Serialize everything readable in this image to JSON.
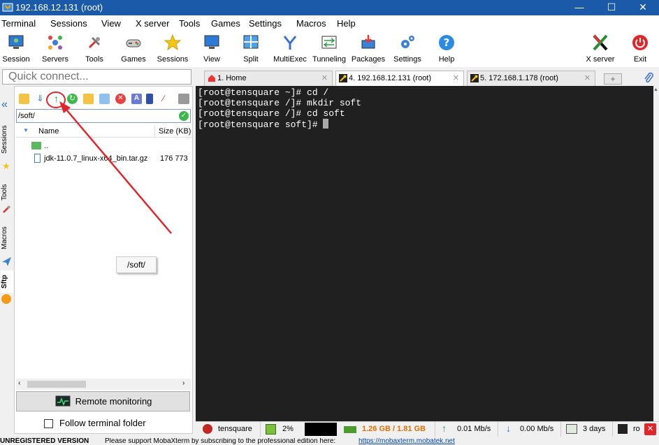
{
  "window": {
    "title": "192.168.12.131 (root)",
    "min": "—",
    "max": "☐",
    "close": "✕"
  },
  "menu": [
    "Terminal",
    "Sessions",
    "View",
    "X server",
    "Tools",
    "Games",
    "Settings",
    "Macros",
    "Help"
  ],
  "toolbar": [
    "Session",
    "Servers",
    "Tools",
    "Games",
    "Sessions",
    "View",
    "Split",
    "MultiExec",
    "Tunneling",
    "Packages",
    "Settings",
    "Help",
    "X server",
    "Exit"
  ],
  "quick_connect": {
    "placeholder": "Quick connect..."
  },
  "tabs": [
    {
      "label": "1. Home"
    },
    {
      "label": "4. 192.168.12.131 (root)"
    },
    {
      "label": "5. 172.168.1.178 (root)"
    }
  ],
  "side_tabs": [
    "Sessions",
    "Tools",
    "Macros",
    "Sftp"
  ],
  "sftp": {
    "path": "/soft/",
    "col_name": "Name",
    "col_size": "Size (KB)",
    "files": [
      {
        "name": "..",
        "size": ""
      },
      {
        "name": "jdk-11.0.7_linux-x64_bin.tar.gz",
        "size": "176 773"
      }
    ],
    "remote_monitoring": "Remote monitoring",
    "follow_terminal": "Follow terminal folder",
    "tooltip": "/soft/"
  },
  "terminal": {
    "lines": [
      "[root@tensquare ~]# cd /",
      "[root@tensquare /]# mkdir soft",
      "[root@tensquare /]# cd soft",
      "[root@tensquare soft]# "
    ]
  },
  "status": {
    "host": "tensquare",
    "cpu": "2%",
    "mem": "1.26 GB / 1.81 GB",
    "up": "0.01 Mb/s",
    "down": "0.00 Mb/s",
    "uptime": "3 days",
    "user": "ro"
  },
  "unregistered": {
    "label": "UNREGISTERED VERSION",
    "message": "Please support MobaXterm by subscribing to the professional edition here:",
    "link": "https://mobaxterm.mobatek.net"
  },
  "colors": {
    "titlebar": "#1a5aa8",
    "terminal_bg": "#202020",
    "mem_text": "#e07000",
    "annotation": "#e0262b"
  }
}
